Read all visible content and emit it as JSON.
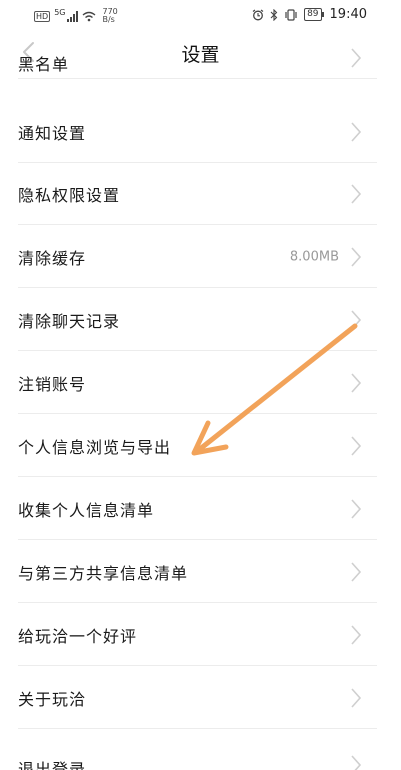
{
  "status_bar": {
    "left_badge": "HD",
    "signal_tech": "5G",
    "net_speed_value": "770",
    "net_speed_unit": "B/s",
    "battery": "89",
    "time": "19:40"
  },
  "header": {
    "title": "设置"
  },
  "rows": [
    {
      "label": "黑名单",
      "value": ""
    },
    {
      "label": "通知设置",
      "value": ""
    },
    {
      "label": "隐私权限设置",
      "value": ""
    },
    {
      "label": "清除缓存",
      "value": "8.00MB"
    },
    {
      "label": "清除聊天记录",
      "value": ""
    },
    {
      "label": "注销账号",
      "value": ""
    },
    {
      "label": "个人信息浏览与导出",
      "value": ""
    },
    {
      "label": "收集个人信息清单",
      "value": ""
    },
    {
      "label": "与第三方共享信息清单",
      "value": ""
    },
    {
      "label": "给玩洽一个好评",
      "value": ""
    },
    {
      "label": "关于玩洽",
      "value": ""
    },
    {
      "label": "退出登录",
      "value": ""
    }
  ],
  "annotation_color": "#F2A35A"
}
